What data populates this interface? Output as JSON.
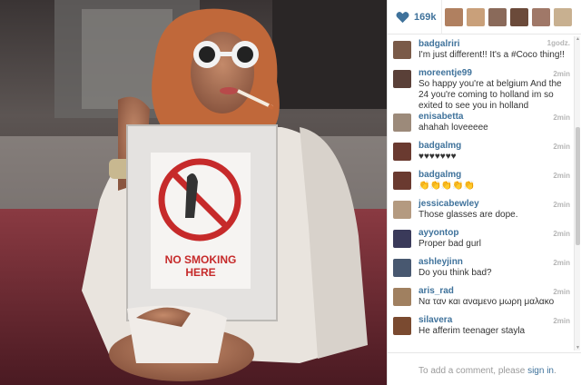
{
  "likes": {
    "count": "169k",
    "heart_color": "#3f729b"
  },
  "likers": [
    {
      "name": "liker-1",
      "color": "#b08060"
    },
    {
      "name": "liker-2",
      "color": "#c9a07a"
    },
    {
      "name": "liker-3",
      "color": "#8a6a5a"
    },
    {
      "name": "liker-4",
      "color": "#6b4a3a"
    },
    {
      "name": "liker-5",
      "color": "#a07868"
    },
    {
      "name": "liker-6",
      "color": "#c8b090"
    }
  ],
  "comments": [
    {
      "user": "badgalriri",
      "text": "I'm just different!! It's a #Coco thing!!",
      "time": "1godz.",
      "avatar": "#7a5a48"
    },
    {
      "user": "moreentje99",
      "text": "So happy you're at belgium And the 24 you're coming to holland im so exited to see you in holland",
      "time": "2min",
      "avatar": "#5a4038"
    },
    {
      "user": "enisabetta",
      "text": "ahahah loveeeee",
      "time": "2min",
      "avatar": "#9c8a7a"
    },
    {
      "user": "badgalmg",
      "text": "♥♥♥♥♥♥♥",
      "time": "2min",
      "avatar": "#6a3a30"
    },
    {
      "user": "badgalmg",
      "text": "👏👏👏👏👏",
      "time": "2min",
      "avatar": "#6a3a30"
    },
    {
      "user": "jessicabewley",
      "text": "Those glasses are dope.",
      "time": "2min",
      "avatar": "#b49a80"
    },
    {
      "user": "ayyontop",
      "text": "Proper bad gurl",
      "time": "2min",
      "avatar": "#3a3a5a"
    },
    {
      "user": "ashleyjinn",
      "text": "Do you think bad?",
      "time": "2min",
      "avatar": "#485870"
    },
    {
      "user": "aris_rad",
      "text": "Να ταν και αναμενο μωρη μαλακο",
      "time": "2min",
      "avatar": "#a08060"
    },
    {
      "user": "silavera",
      "text": "He afferim teenager stayla",
      "time": "2min",
      "avatar": "#7a4a30"
    }
  ],
  "footer": {
    "prefix": "To add a comment, please ",
    "link": "sign in",
    "suffix": "."
  },
  "photo": {
    "sign_text_1": "NO SMOKING",
    "sign_text_2": "HERE"
  }
}
